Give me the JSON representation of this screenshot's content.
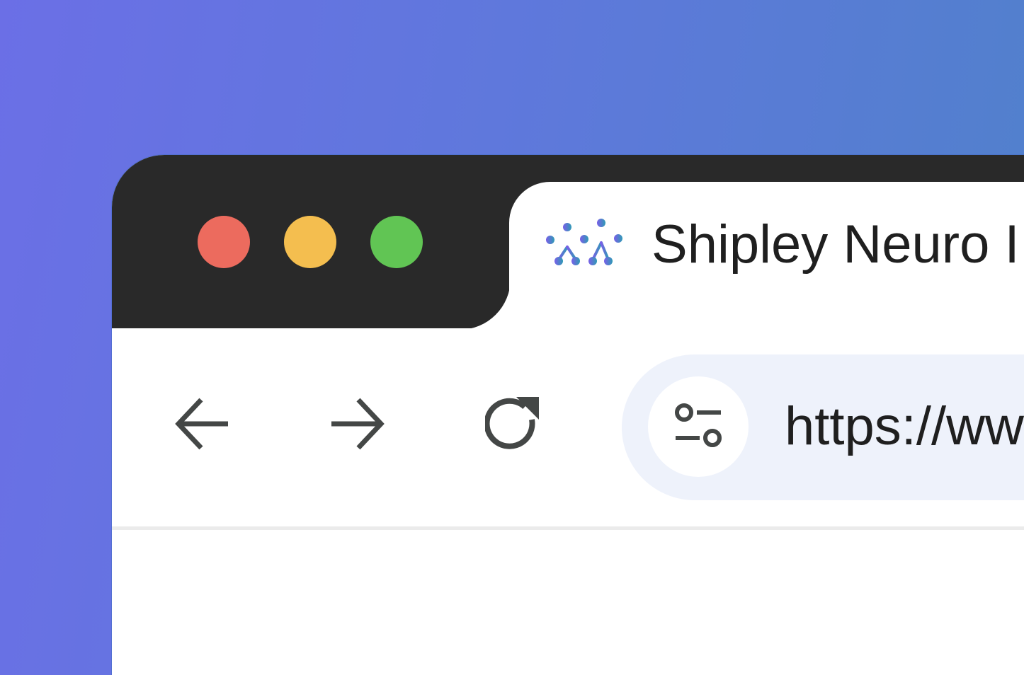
{
  "window": {
    "controls": [
      {
        "name": "close",
        "color": "#ec6b5e"
      },
      {
        "name": "minimize",
        "color": "#f4be4f"
      },
      {
        "name": "maximize",
        "color": "#61c554"
      }
    ]
  },
  "tab": {
    "title": "Shipley Neuro I",
    "icon": "people-network-logo-icon"
  },
  "toolbar": {
    "back_icon": "arrow-left-icon",
    "forward_icon": "arrow-right-icon",
    "reload_icon": "reload-icon",
    "site_info_icon": "tune-sliders-icon"
  },
  "address_bar": {
    "url": "https://ww"
  },
  "colors": {
    "titlebar": "#292929",
    "address_bg": "#eef2fb",
    "icon_gray": "#444746"
  }
}
